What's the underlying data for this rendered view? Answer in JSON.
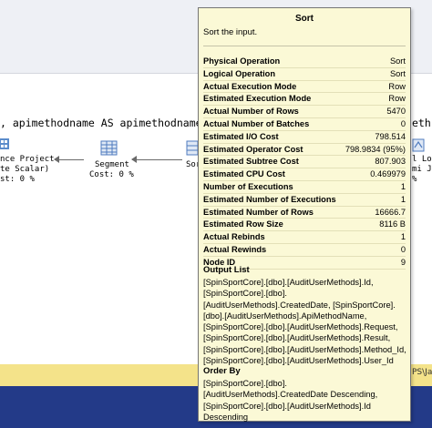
{
  "editor": {
    "sql_text": ", apimethodname AS apimethodname , r",
    "sql_text_right": "eth"
  },
  "plan": {
    "nodes": {
      "compute_scalar_label_1": "nce Project",
      "compute_scalar_label_2": "te Scalar)",
      "compute_scalar_cost": "st: 0 %",
      "segment_label": "Segment",
      "segment_cost": "Cost: 0 %",
      "sort_label_partial": "Sor",
      "right_label_1": "l Loo",
      "right_label_2": "mi J",
      "right_label_3": "%"
    }
  },
  "footer": {
    "text": "PS\\Jai"
  },
  "tooltip": {
    "title": "Sort",
    "description": "Sort the input.",
    "properties": [
      {
        "label": "Physical Operation",
        "value": "Sort"
      },
      {
        "label": "Logical Operation",
        "value": "Sort"
      },
      {
        "label": "Actual Execution Mode",
        "value": "Row"
      },
      {
        "label": "Estimated Execution Mode",
        "value": "Row"
      },
      {
        "label": "Actual Number of Rows",
        "value": "5470"
      },
      {
        "label": "Actual Number of Batches",
        "value": "0"
      },
      {
        "label": "Estimated I/O Cost",
        "value": "798.514"
      },
      {
        "label": "Estimated Operator Cost",
        "value": "798.9834 (95%)"
      },
      {
        "label": "Estimated Subtree Cost",
        "value": "807.903"
      },
      {
        "label": "Estimated CPU Cost",
        "value": "0.469979"
      },
      {
        "label": "Number of Executions",
        "value": "1"
      },
      {
        "label": "Estimated Number of Executions",
        "value": "1"
      },
      {
        "label": "Estimated Number of Rows",
        "value": "16666.7"
      },
      {
        "label": "Estimated Row Size",
        "value": "8116 B"
      },
      {
        "label": "Actual Rebinds",
        "value": "1"
      },
      {
        "label": "Actual Rewinds",
        "value": "0"
      },
      {
        "label": "Node ID",
        "value": "9"
      }
    ],
    "output_list": {
      "title": "Output List",
      "lines": [
        "[SpinSportCore].[dbo].[AuditUserMethods].Id,",
        "[SpinSportCore].[dbo].",
        "[AuditUserMethods].CreatedDate, [SpinSportCore].",
        "[dbo].[AuditUserMethods].ApiMethodName,",
        "[SpinSportCore].[dbo].[AuditUserMethods].Request,",
        "[SpinSportCore].[dbo].[AuditUserMethods].Result,",
        "[SpinSportCore].[dbo].[AuditUserMethods].Method_Id,",
        "[SpinSportCore].[dbo].[AuditUserMethods].User_Id"
      ]
    },
    "order_by": {
      "title": "Order By",
      "lines": [
        "[SpinSportCore].[dbo].",
        "[AuditUserMethods].CreatedDate Descending,",
        "[SpinSportCore].[dbo].[AuditUserMethods].Id",
        "Descending"
      ]
    }
  }
}
